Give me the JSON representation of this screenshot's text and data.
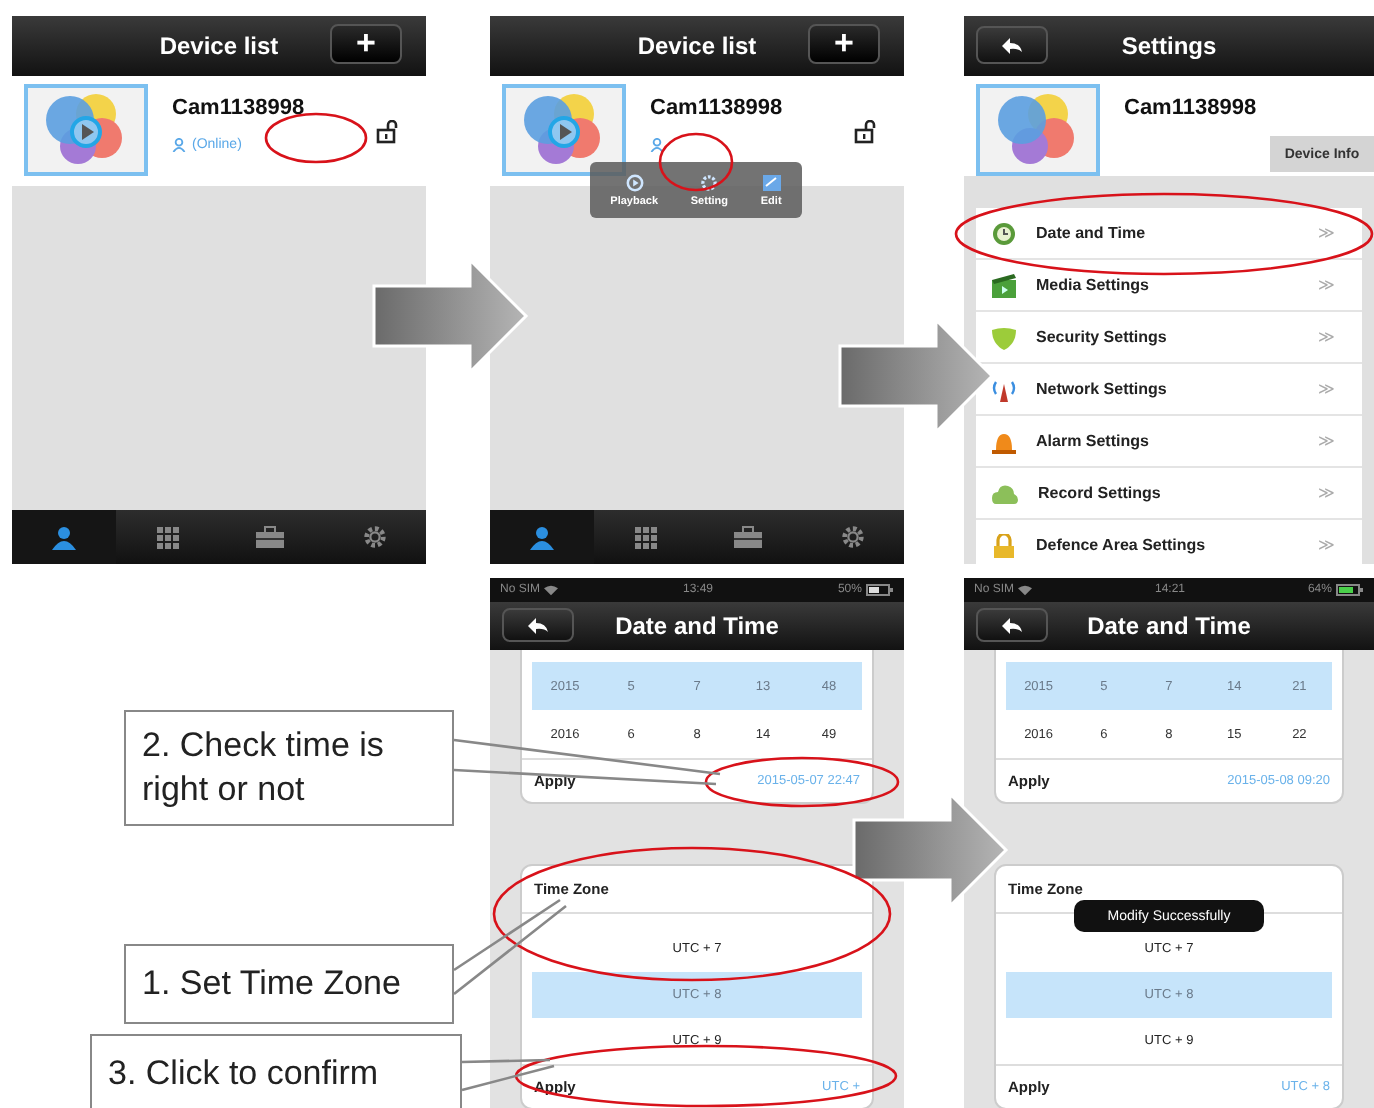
{
  "device_list": {
    "title": "Device list",
    "add_button": "+",
    "device": {
      "name": "Cam1138998",
      "status": "(Online)"
    },
    "tabs": [
      {
        "selected": true
      },
      {
        "selected": false
      },
      {
        "selected": false
      },
      {
        "selected": false
      }
    ]
  },
  "device_list_menu": {
    "title": "Device list",
    "add_button": "+",
    "device": {
      "name": "Cam1138998"
    },
    "menu": [
      {
        "label": "Playback"
      },
      {
        "label": "Setting"
      },
      {
        "label": "Edit"
      }
    ],
    "tabs": [
      {
        "selected": true
      },
      {
        "selected": false
      },
      {
        "selected": false
      },
      {
        "selected": false
      }
    ]
  },
  "settings": {
    "title": "Settings",
    "device": {
      "name": "Cam1138998"
    },
    "info_button": "Device Info",
    "items": [
      {
        "label": "Date and Time",
        "chevron": "≫"
      },
      {
        "label": "Media Settings",
        "chevron": "≫"
      },
      {
        "label": "Security Settings",
        "chevron": "≫"
      },
      {
        "label": "Network Settings",
        "chevron": "≫"
      },
      {
        "label": "Alarm Settings",
        "chevron": "≫"
      },
      {
        "label": "Record Settings",
        "chevron": "≫"
      },
      {
        "label": "Defence Area Settings",
        "chevron": "≫"
      }
    ]
  },
  "date_screens": [
    {
      "status_bar": {
        "carrier": "No SIM",
        "time": "13:49",
        "battery": "50%"
      },
      "title": "Date and Time",
      "picker_rows": [
        {
          "cells": [
            "2015",
            "5",
            "7",
            "13",
            "48"
          ],
          "selected": true
        },
        {
          "cells": [
            "2016",
            "6",
            "8",
            "14",
            "49"
          ],
          "selected": false
        }
      ],
      "apply_label": "Apply",
      "date_value": "2015-05-07 22:47",
      "zone_header": "Time Zone",
      "zones": [
        {
          "label": "UTC + 7",
          "selected": false
        },
        {
          "label": "UTC + 8",
          "selected": true
        },
        {
          "label": "UTC + 9",
          "selected": false
        }
      ],
      "zone_apply_label": "Apply",
      "zone_value": "UTC +"
    },
    {
      "status_bar": {
        "carrier": "No SIM",
        "time": "14:21",
        "battery": "64%"
      },
      "title": "Date and Time",
      "picker_rows": [
        {
          "cells": [
            "2015",
            "5",
            "7",
            "14",
            "21"
          ],
          "selected": true
        },
        {
          "cells": [
            "2016",
            "6",
            "8",
            "15",
            "22"
          ],
          "selected": false
        }
      ],
      "apply_label": "Apply",
      "date_value": "2015-05-08 09:20",
      "toast": "Modify Successfully",
      "zone_header": "Time Zone",
      "zones": [
        {
          "label": "UTC + 7",
          "selected": false
        },
        {
          "label": "UTC + 8",
          "selected": true
        },
        {
          "label": "UTC + 9",
          "selected": false
        }
      ],
      "zone_apply_label": "Apply",
      "zone_value": "UTC + 8"
    }
  ],
  "callouts": [
    {
      "text": "2. Check time is right or not"
    },
    {
      "text": "1. Set Time Zone"
    },
    {
      "text": "3. Click to confirm"
    }
  ]
}
